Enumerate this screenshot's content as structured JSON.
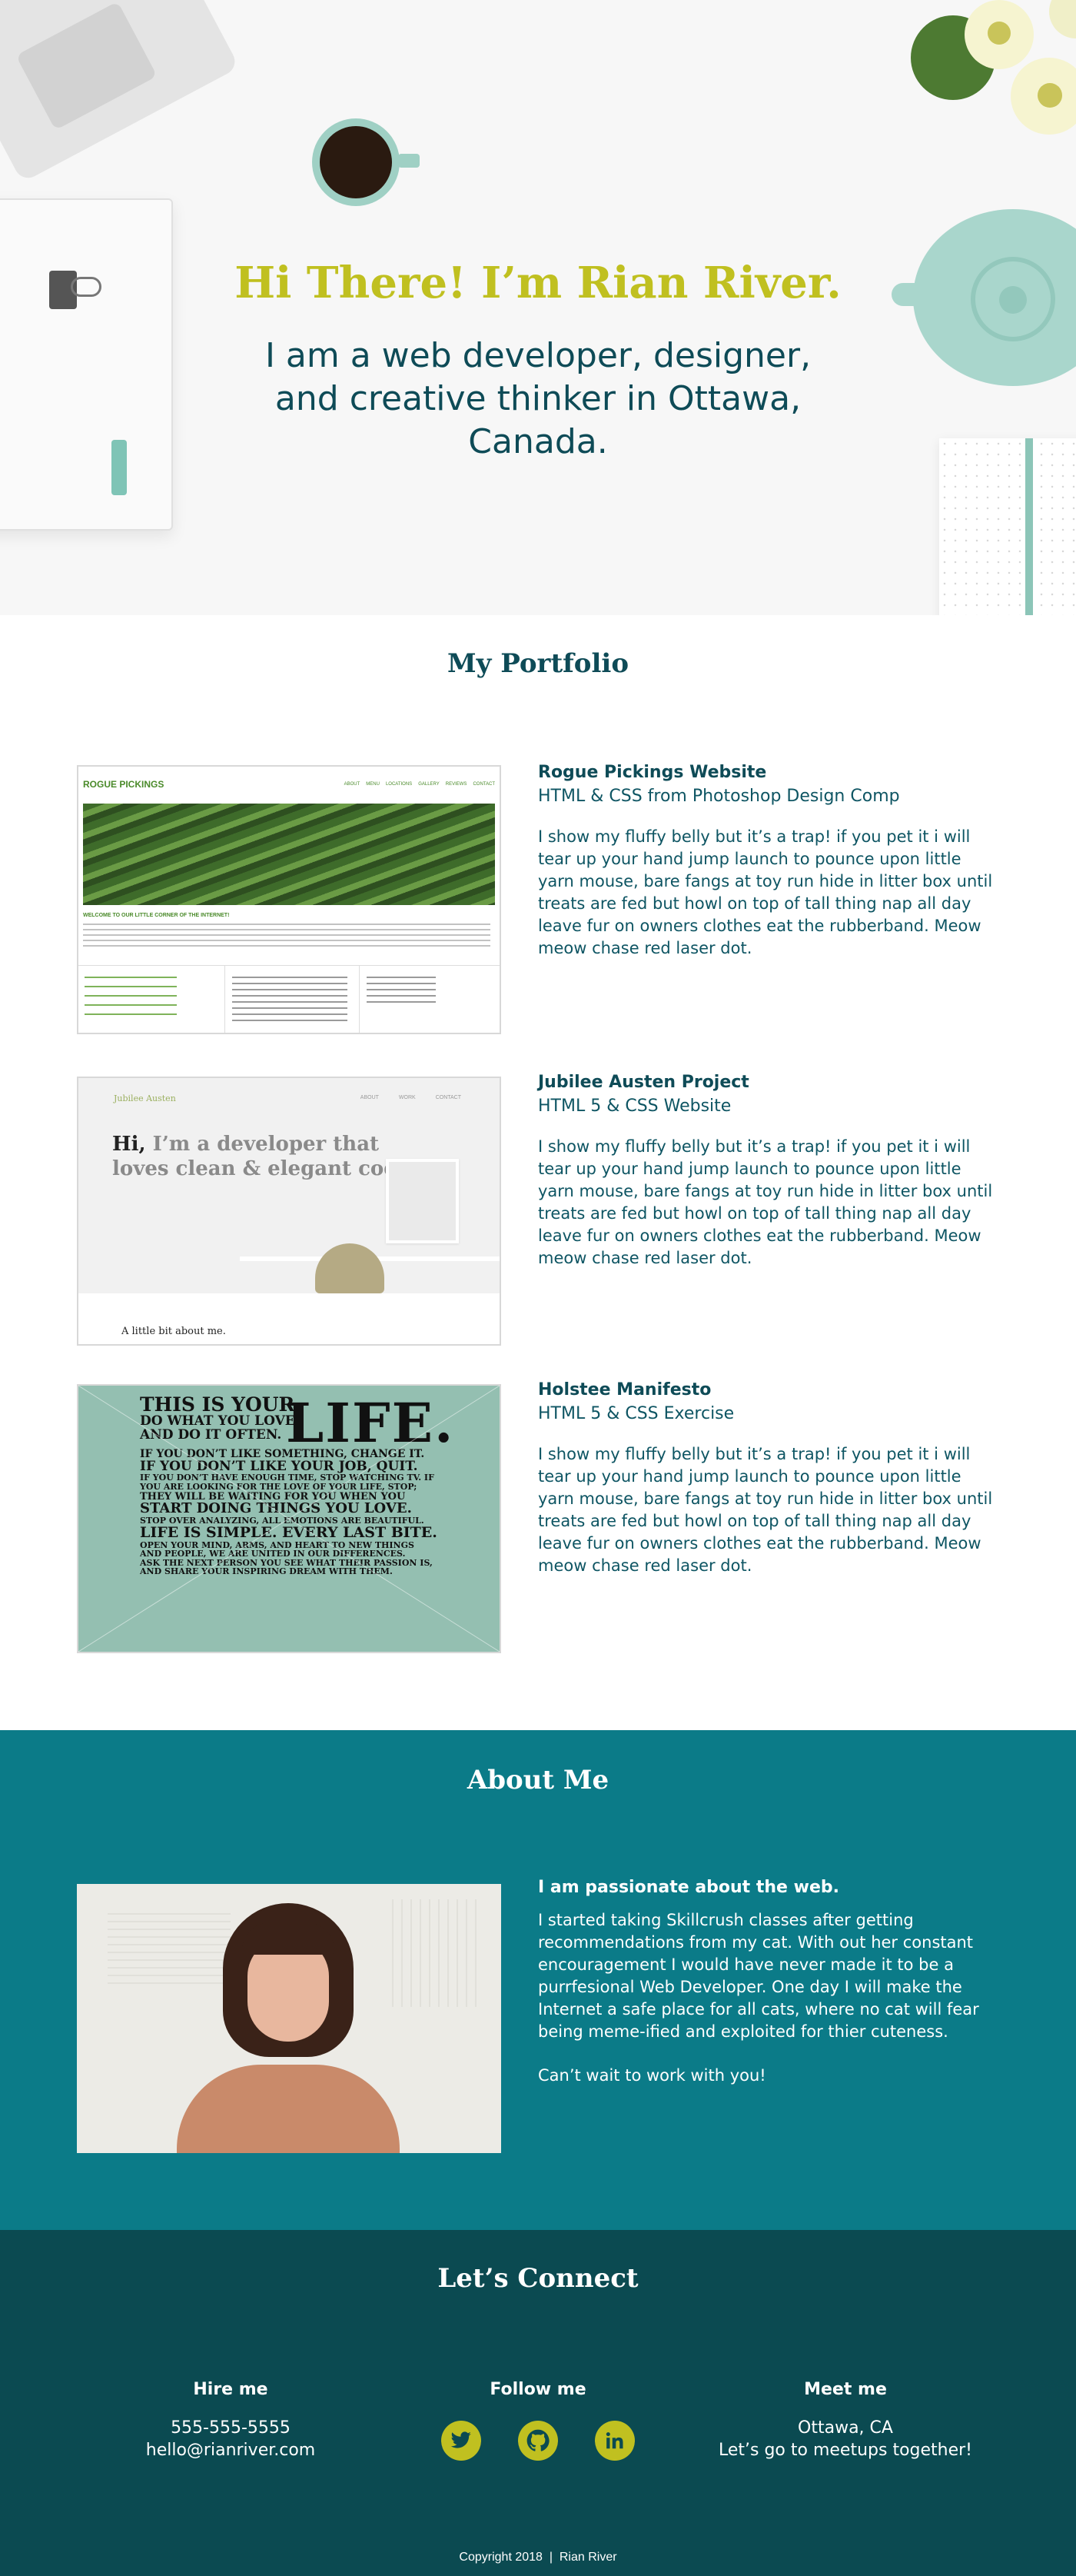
{
  "hero": {
    "title": "Hi There! I’m Rian River.",
    "subtitle": "I am a web developer, designer, and creative thinker in Ottawa, Canada."
  },
  "portfolio": {
    "heading": "My Portfolio",
    "projects": [
      {
        "title": "Rogue Pickings Website",
        "subtitle": "HTML & CSS from Photoshop Design Comp",
        "description": "I show my fluffy belly but it’s a trap! if you pet it i will tear up your hand jump launch to pounce upon little yarn mouse, bare fangs at toy run hide in litter box until treats are fed but howl on top of tall thing nap all day leave fur on owners clothes eat the rubberband. Meow meow chase red laser dot.",
        "thumb": {
          "logo": "ROGUE PICKINGS",
          "nav": [
            "ABOUT",
            "MENU",
            "LOCATIONS",
            "GALLERY",
            "REVIEWS",
            "CONTACT"
          ],
          "welcome": "WELCOME TO OUR LITTLE CORNER OF THE INTERNET!"
        }
      },
      {
        "title": "Jubilee Austen Project",
        "subtitle": "HTML 5 & CSS Website",
        "description": "I show my fluffy belly but it’s a trap! if you pet it i will tear up your hand jump launch to pounce upon little yarn mouse, bare fangs at toy run hide in litter box until treats are fed but howl on top of tall thing nap all day leave fur on owners clothes eat the rubberband. Meow meow chase red laser dot.",
        "thumb": {
          "logo": "Jubilee Austen",
          "nav": [
            "ABOUT",
            "WORK",
            "CONTACT"
          ],
          "hi": "Hi,",
          "tagline": "I’m a developer that loves clean & elegant code.",
          "bottom": "A little bit about me."
        }
      },
      {
        "title": "Holstee Manifesto",
        "subtitle": "HTML 5 & CSS Exercise",
        "description": "I show my fluffy belly but it’s a trap! if you pet it i will tear up your hand jump launch to pounce upon little yarn mouse, bare fangs at toy run hide in litter box until treats are fed but howl on top of tall thing nap all day leave fur on owners clothes eat the rubberband. Meow meow chase red laser dot.",
        "thumb": {
          "line1": "THIS IS YOUR",
          "life": "LIFE.",
          "line2": "DO WHAT YOU LOVE,",
          "line3": "AND DO IT OFTEN.",
          "line4": "IF YOU DON’T LIKE SOMETHING, CHANGE IT.",
          "line5": "IF YOU DON’T LIKE YOUR JOB, QUIT.",
          "line6": "IF YOU DON’T HAVE ENOUGH TIME, STOP WATCHING TV. IF",
          "line7": "YOU ARE LOOKING FOR THE LOVE OF YOUR LIFE, STOP;",
          "line8": "THEY WILL BE WAITING FOR YOU WHEN YOU",
          "line9": "START DOING THINGS YOU LOVE.",
          "line10": "STOP OVER ANALYZING, ALL EMOTIONS ARE BEAUTIFUL.",
          "line11": "LIFE IS SIMPLE. EVERY LAST BITE.",
          "line12": "OPEN YOUR MIND, ARMS, AND HEART TO NEW THINGS",
          "line13": "AND PEOPLE, WE ARE UNITED IN OUR DIFFERENCES.",
          "line14": "ASK THE NEXT PERSON YOU SEE WHAT THEIR PASSION IS,",
          "line15": "AND SHARE YOUR INSPIRING DREAM WITH THEM."
        }
      }
    ]
  },
  "about": {
    "heading": "About Me",
    "lead": "I am passionate about the web.",
    "body": "I started taking Skillcrush classes after getting recommendations from my cat. With out her constant encouragement I would have never made it to be a purrfesional Web Developer. One day I will make the Internet a safe place for all cats, where no cat will fear being meme-ified and exploited for thier cuteness.",
    "closing": "Can’t wait to work with you!"
  },
  "connect": {
    "heading": "Let’s Connect",
    "hire": {
      "label": "Hire me",
      "phone": "555-555-5555",
      "email": "hello@rianriver.com"
    },
    "follow": {
      "label": "Follow me",
      "icons": [
        "twitter-icon",
        "github-icon",
        "linkedin-icon"
      ]
    },
    "meet": {
      "label": "Meet me",
      "city": "Ottawa, CA",
      "note": "Let’s go to meetups together!"
    }
  },
  "footer": {
    "copyright": "Copyright 2018  |  Rian River"
  },
  "colors": {
    "accent": "#c0c020",
    "text_dark": "#0e4b57",
    "about_bg": "#0b7b88",
    "connect_bg": "#0b4a51"
  }
}
